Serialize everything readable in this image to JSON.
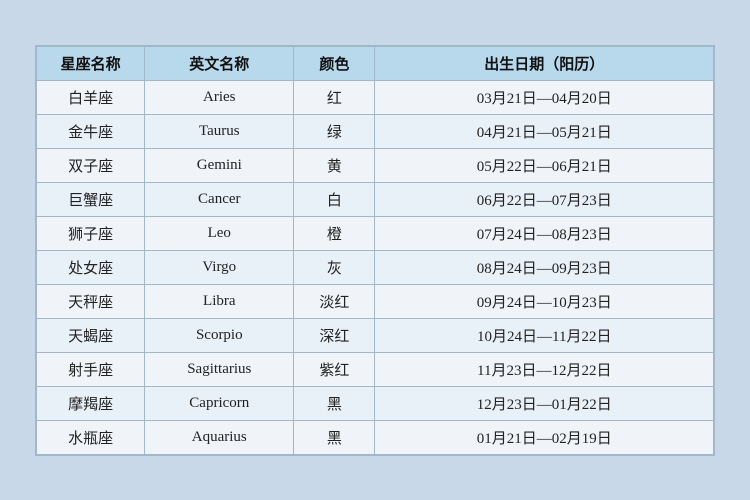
{
  "table": {
    "headers": {
      "zh_name": "星座名称",
      "en_name": "英文名称",
      "color": "颜色",
      "date": "出生日期（阳历）"
    },
    "rows": [
      {
        "zh": "白羊座",
        "en": "Aries",
        "color": "红",
        "date": "03月21日—04月20日"
      },
      {
        "zh": "金牛座",
        "en": "Taurus",
        "color": "绿",
        "date": "04月21日—05月21日"
      },
      {
        "zh": "双子座",
        "en": "Gemini",
        "color": "黄",
        "date": "05月22日—06月21日"
      },
      {
        "zh": "巨蟹座",
        "en": "Cancer",
        "color": "白",
        "date": "06月22日—07月23日"
      },
      {
        "zh": "狮子座",
        "en": "Leo",
        "color": "橙",
        "date": "07月24日—08月23日"
      },
      {
        "zh": "处女座",
        "en": "Virgo",
        "color": "灰",
        "date": "08月24日—09月23日"
      },
      {
        "zh": "天秤座",
        "en": "Libra",
        "color": "淡红",
        "date": "09月24日—10月23日"
      },
      {
        "zh": "天蝎座",
        "en": "Scorpio",
        "color": "深红",
        "date": "10月24日—11月22日"
      },
      {
        "zh": "射手座",
        "en": "Sagittarius",
        "color": "紫红",
        "date": "11月23日—12月22日"
      },
      {
        "zh": "摩羯座",
        "en": "Capricorn",
        "color": "黑",
        "date": "12月23日—01月22日"
      },
      {
        "zh": "水瓶座",
        "en": "Aquarius",
        "color": "黑",
        "date": "01月21日—02月19日"
      }
    ]
  }
}
